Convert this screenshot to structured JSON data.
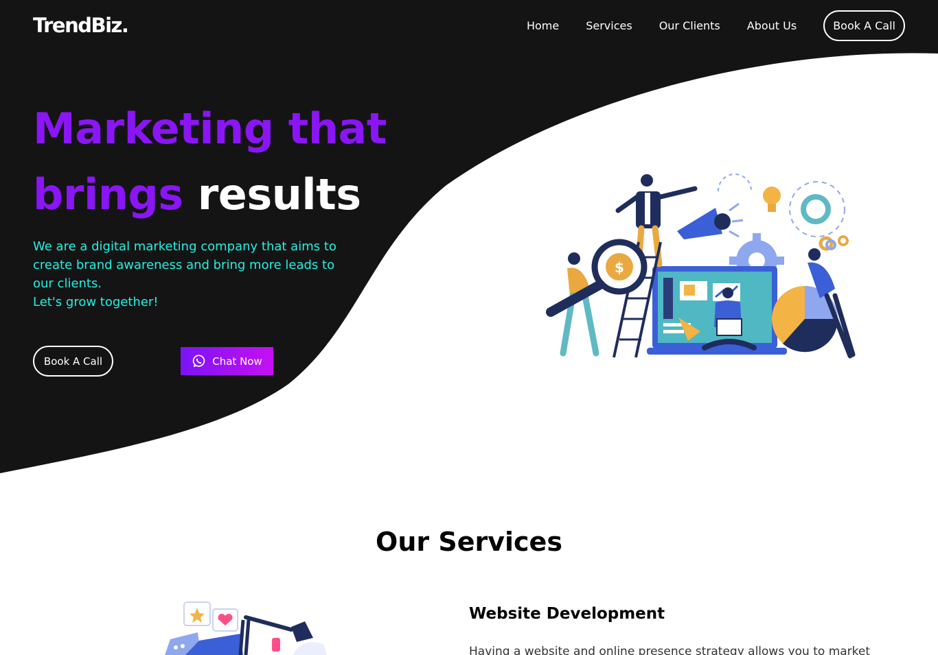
{
  "header": {
    "logo": "TrendBiz.",
    "nav": {
      "home": "Home",
      "services": "Services",
      "clients": "Our Clients",
      "about": "About Us",
      "cta": "Book A Call"
    }
  },
  "hero": {
    "title_line1": "Marketing that",
    "title_word_purple": "brings",
    "title_word_white": "results",
    "subtitle_lines": [
      "We are a digital marketing company that aims to create brand awareness and bring more leads to our clients.",
      "Let's grow together!"
    ],
    "book_button": "Book A Call",
    "chat_button": "Chat Now"
  },
  "services": {
    "heading": "Our Services",
    "first": {
      "title": "Website Development",
      "description": "Having a website and online presence strategy allows you to market"
    }
  },
  "colors": {
    "dark_bg": "#141414",
    "purple": "#8a15f5",
    "cyan": "#24f0e2",
    "chat_gradient_end": "#c60ff3"
  },
  "icons": {
    "chat_button_icon": "whatsapp-icon"
  }
}
